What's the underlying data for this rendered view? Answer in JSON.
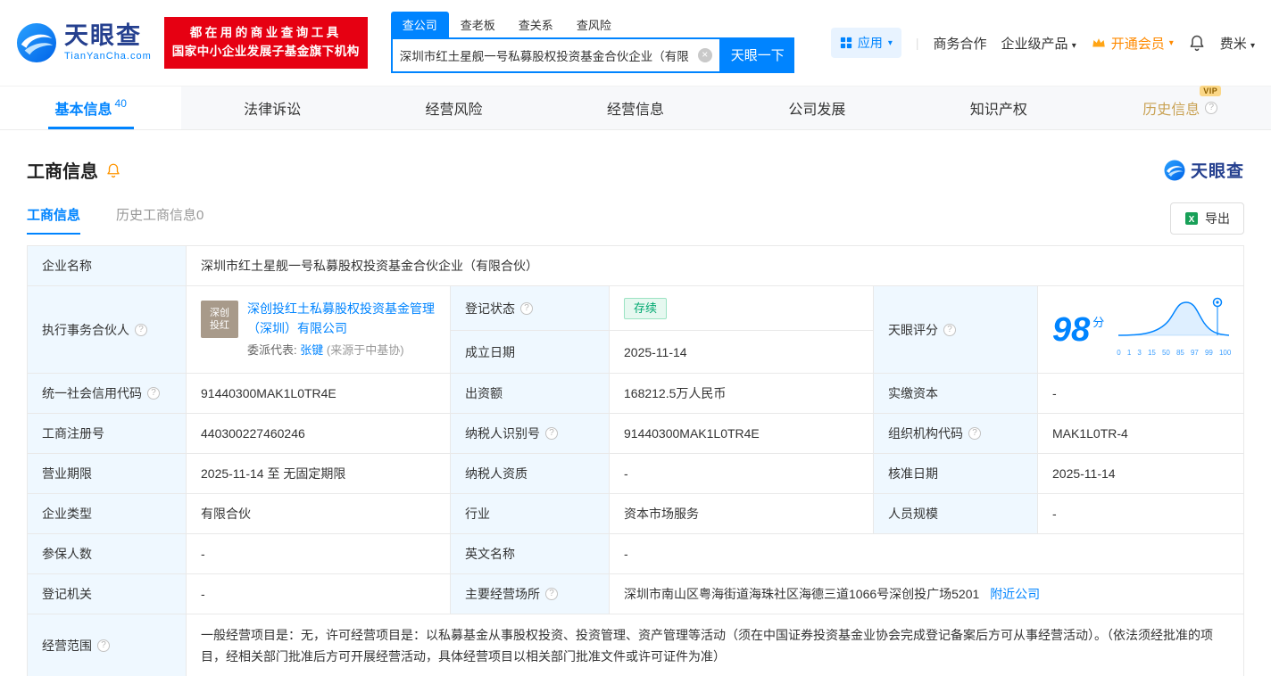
{
  "colors": {
    "brand_blue": "#0084ff",
    "logo_navy": "#25408f",
    "promo_red": "#e60012",
    "vip_orange": "#ff8a00",
    "history_gold": "#c9a254",
    "status_green": "#00a870",
    "label_cell_bg": "#eff8ff"
  },
  "header": {
    "logo": {
      "brand": "天眼查",
      "domain": "TianYanCha.com"
    },
    "promo": {
      "line1": "都在用的商业查询工具",
      "line2": "国家中小企业发展子基金旗下机构"
    },
    "search": {
      "tabs": [
        {
          "label": "查公司"
        },
        {
          "label": "查老板"
        },
        {
          "label": "查关系"
        },
        {
          "label": "查风险"
        }
      ],
      "value": "深圳市红土星舰一号私募股权投资基金合伙企业（有限",
      "button": "天眼一下"
    },
    "nav": {
      "apps": "应用",
      "cooperation": "商务合作",
      "enterprise": "企业级产品",
      "vip": "开通会员",
      "user": "费米"
    }
  },
  "nav_tabs": [
    {
      "label": "基本信息",
      "count": "40"
    },
    {
      "label": "法律诉讼"
    },
    {
      "label": "经营风险"
    },
    {
      "label": "经营信息"
    },
    {
      "label": "公司发展"
    },
    {
      "label": "知识产权"
    },
    {
      "label": "历史信息",
      "vip_badge": "VIP"
    }
  ],
  "section": {
    "title": "工商信息",
    "brand": "天眼查",
    "subtabs": [
      {
        "label": "工商信息"
      },
      {
        "label": "历史工商信息0"
      }
    ],
    "export_label": "导出"
  },
  "info": {
    "company_name": {
      "label": "企业名称",
      "value": "深圳市红土星舰一号私募股权投资基金合伙企业（有限合伙）"
    },
    "executive_partner": {
      "label": "执行事务合伙人",
      "logo_line1": "深创",
      "logo_line2": "投红",
      "name": "深创投红土私募股权投资基金管理（深圳）有限公司",
      "delegate_label": "委派代表:",
      "delegate_name": "张键",
      "delegate_source": "(来源于中基协)"
    },
    "reg_status": {
      "label": "登记状态",
      "value": "存续"
    },
    "establish_date": {
      "label": "成立日期",
      "value": "2025-11-14"
    },
    "score": {
      "label": "天眼评分",
      "value": "98",
      "unit": "分",
      "axis": [
        "0",
        "1",
        "3",
        "15",
        "50",
        "85",
        "97",
        "99",
        "100"
      ]
    },
    "credit_code": {
      "label": "统一社会信用代码",
      "value": "91440300MAK1L0TR4E"
    },
    "capital": {
      "label": "出资额",
      "value": "168212.5万人民币"
    },
    "paid_capital": {
      "label": "实缴资本",
      "value": "-"
    },
    "reg_number": {
      "label": "工商注册号",
      "value": "440300227460246"
    },
    "taxpayer_id": {
      "label": "纳税人识别号",
      "value": "91440300MAK1L0TR4E"
    },
    "org_code": {
      "label": "组织机构代码",
      "value": "MAK1L0TR-4"
    },
    "business_term": {
      "label": "营业期限",
      "value": "2025-11-14 至 无固定期限"
    },
    "taxpayer_quality": {
      "label": "纳税人资质",
      "value": "-"
    },
    "approval_date": {
      "label": "核准日期",
      "value": "2025-11-14"
    },
    "company_type": {
      "label": "企业类型",
      "value": "有限合伙"
    },
    "industry": {
      "label": "行业",
      "value": "资本市场服务"
    },
    "staff_size": {
      "label": "人员规模",
      "value": "-"
    },
    "insured_count": {
      "label": "参保人数",
      "value": "-"
    },
    "english_name": {
      "label": "英文名称",
      "value": "-"
    },
    "reg_authority": {
      "label": "登记机关",
      "value": "-"
    },
    "business_address": {
      "label": "主要经营场所",
      "value": "深圳市南山区粤海街道海珠社区海德三道1066号深创投广场5201",
      "link": "附近公司"
    },
    "business_scope": {
      "label": "经营范围",
      "value": "一般经营项目是：无，许可经营项目是：以私募基金从事股权投资、投资管理、资产管理等活动（须在中国证券投资基金业协会完成登记备案后方可从事经营活动）。（依法须经批准的项目，经相关部门批准后方可开展经营活动，具体经营项目以相关部门批准文件或许可证件为准）"
    }
  }
}
